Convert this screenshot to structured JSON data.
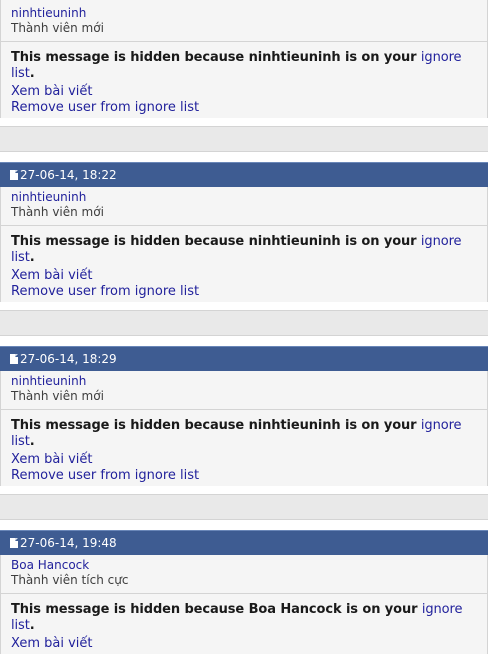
{
  "posts": [
    {
      "date": "",
      "username": "ninhtieuninh",
      "usertitle": "Thành viên mới",
      "hidden_prefix": "This message is hidden because ninhtieuninh is on your ",
      "ignore_link": "ignore list",
      "hidden_suffix": ".",
      "view_post": "Xem bài viết",
      "remove": "Remove user from ignore list"
    },
    {
      "date": "27-06-14, 18:22",
      "username": "ninhtieuninh",
      "usertitle": "Thành viên mới",
      "hidden_prefix": "This message is hidden because ninhtieuninh is on your ",
      "ignore_link": "ignore list",
      "hidden_suffix": ".",
      "view_post": "Xem bài viết",
      "remove": "Remove user from ignore list"
    },
    {
      "date": "27-06-14, 18:29",
      "username": "ninhtieuninh",
      "usertitle": "Thành viên mới",
      "hidden_prefix": "This message is hidden because ninhtieuninh is on your ",
      "ignore_link": "ignore list",
      "hidden_suffix": ".",
      "view_post": "Xem bài viết",
      "remove": "Remove user from ignore list"
    },
    {
      "date": "27-06-14, 19:48",
      "username": "Boa Hancock",
      "usertitle": "Thành viên tích cực",
      "hidden_prefix": "This message is hidden because Boa Hancock is on your ",
      "ignore_link": "ignore list",
      "hidden_suffix": ".",
      "view_post": "Xem bài viết",
      "remove": ""
    }
  ]
}
